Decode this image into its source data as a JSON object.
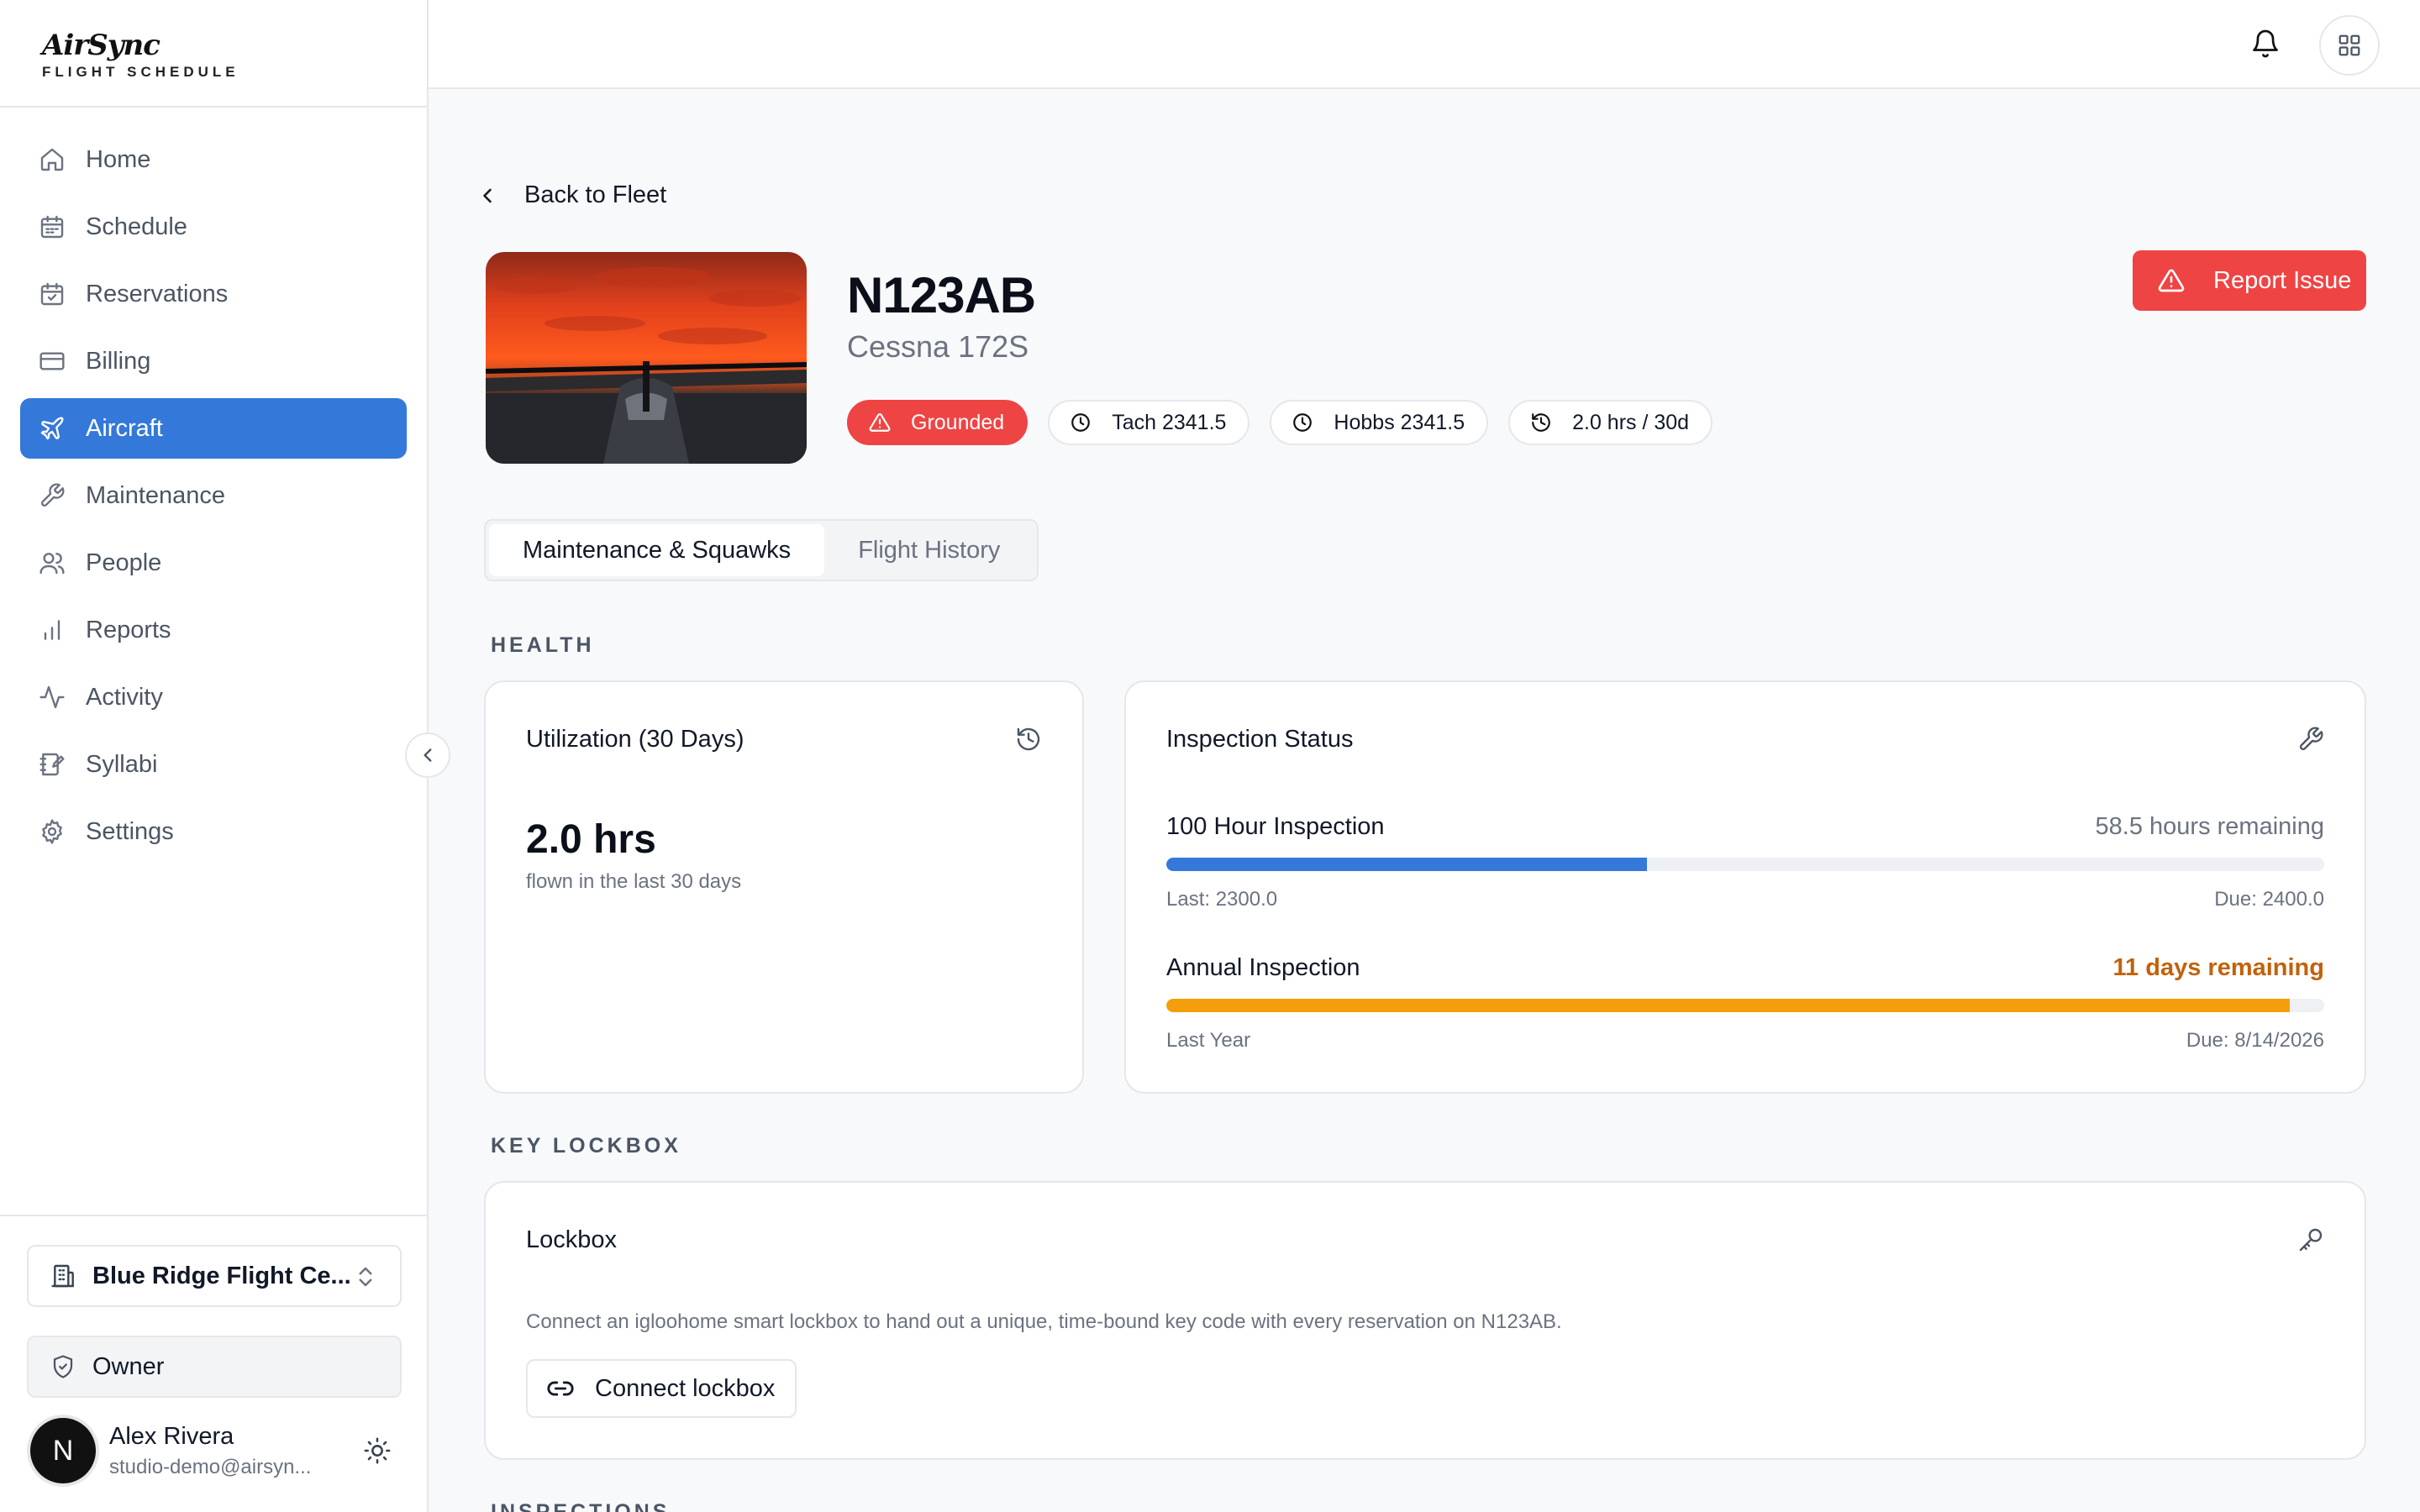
{
  "brand": {
    "name": "AirSync",
    "subtitle": "FLIGHT SCHEDULE"
  },
  "sidebar": {
    "items": [
      {
        "label": "Home",
        "icon": "home-icon"
      },
      {
        "label": "Schedule",
        "icon": "calendar-icon"
      },
      {
        "label": "Reservations",
        "icon": "calendar-check-icon"
      },
      {
        "label": "Billing",
        "icon": "credit-card-icon"
      },
      {
        "label": "Aircraft",
        "icon": "plane-icon",
        "active": true
      },
      {
        "label": "Maintenance",
        "icon": "wrench-icon"
      },
      {
        "label": "People",
        "icon": "users-icon"
      },
      {
        "label": "Reports",
        "icon": "bar-chart-icon"
      },
      {
        "label": "Activity",
        "icon": "activity-icon"
      },
      {
        "label": "Syllabi",
        "icon": "notebook-icon"
      },
      {
        "label": "Settings",
        "icon": "gear-icon"
      }
    ],
    "org": "Blue Ridge Flight Ce...",
    "role": "Owner",
    "user": {
      "initial": "N",
      "name": "Alex Rivera",
      "email": "studio-demo@airsyn..."
    }
  },
  "header": {
    "back_label": "Back to Fleet"
  },
  "aircraft": {
    "tail": "N123AB",
    "model": "Cessna 172S",
    "badges": {
      "status": "Grounded",
      "tach": "Tach 2341.5",
      "hobbs": "Hobbs 2341.5",
      "usage": "2.0 hrs / 30d"
    },
    "report_label": "Report Issue"
  },
  "tabs": [
    {
      "label": "Maintenance & Squawks",
      "active": true
    },
    {
      "label": "Flight History"
    }
  ],
  "sections": {
    "health": "HEALTH",
    "lockbox": "KEY LOCKBOX",
    "inspections": "INSPECTIONS"
  },
  "utilization": {
    "title": "Utilization (30 Days)",
    "value": "2.0 hrs",
    "sub": "flown in the last 30 days"
  },
  "inspection": {
    "title": "Inspection Status",
    "items": [
      {
        "name": "100 Hour Inspection",
        "remaining": "58.5 hours remaining",
        "last": "Last: 2300.0",
        "due": "Due: 2400.0",
        "progress": 0.415,
        "color": "#3478d9"
      },
      {
        "name": "Annual Inspection",
        "remaining": "11 days remaining",
        "last": "Last Year",
        "due": "Due: 8/14/2026",
        "progress": 0.97,
        "color": "#f59e0b"
      }
    ]
  },
  "lockbox": {
    "title": "Lockbox",
    "description": "Connect an igloohome smart lockbox to hand out a unique, time-bound key code with every reservation on N123AB.",
    "button_label": "Connect lockbox"
  },
  "colors": {
    "accent": "#3478d9",
    "danger": "#ef4444",
    "warning": "#c2620a"
  }
}
